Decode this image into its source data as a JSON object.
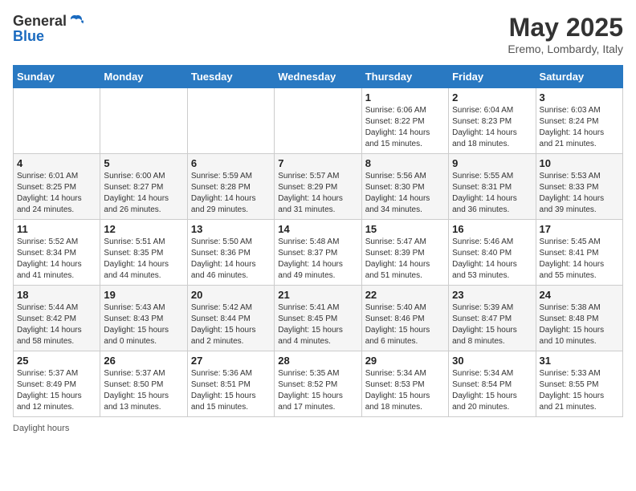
{
  "header": {
    "logo_general": "General",
    "logo_blue": "Blue",
    "title": "May 2025",
    "subtitle": "Eremo, Lombardy, Italy"
  },
  "days_of_week": [
    "Sunday",
    "Monday",
    "Tuesday",
    "Wednesday",
    "Thursday",
    "Friday",
    "Saturday"
  ],
  "weeks": [
    [
      {
        "day": "",
        "info": ""
      },
      {
        "day": "",
        "info": ""
      },
      {
        "day": "",
        "info": ""
      },
      {
        "day": "",
        "info": ""
      },
      {
        "day": "1",
        "info": "Sunrise: 6:06 AM\nSunset: 8:22 PM\nDaylight: 14 hours and 15 minutes."
      },
      {
        "day": "2",
        "info": "Sunrise: 6:04 AM\nSunset: 8:23 PM\nDaylight: 14 hours and 18 minutes."
      },
      {
        "day": "3",
        "info": "Sunrise: 6:03 AM\nSunset: 8:24 PM\nDaylight: 14 hours and 21 minutes."
      }
    ],
    [
      {
        "day": "4",
        "info": "Sunrise: 6:01 AM\nSunset: 8:25 PM\nDaylight: 14 hours and 24 minutes."
      },
      {
        "day": "5",
        "info": "Sunrise: 6:00 AM\nSunset: 8:27 PM\nDaylight: 14 hours and 26 minutes."
      },
      {
        "day": "6",
        "info": "Sunrise: 5:59 AM\nSunset: 8:28 PM\nDaylight: 14 hours and 29 minutes."
      },
      {
        "day": "7",
        "info": "Sunrise: 5:57 AM\nSunset: 8:29 PM\nDaylight: 14 hours and 31 minutes."
      },
      {
        "day": "8",
        "info": "Sunrise: 5:56 AM\nSunset: 8:30 PM\nDaylight: 14 hours and 34 minutes."
      },
      {
        "day": "9",
        "info": "Sunrise: 5:55 AM\nSunset: 8:31 PM\nDaylight: 14 hours and 36 minutes."
      },
      {
        "day": "10",
        "info": "Sunrise: 5:53 AM\nSunset: 8:33 PM\nDaylight: 14 hours and 39 minutes."
      }
    ],
    [
      {
        "day": "11",
        "info": "Sunrise: 5:52 AM\nSunset: 8:34 PM\nDaylight: 14 hours and 41 minutes."
      },
      {
        "day": "12",
        "info": "Sunrise: 5:51 AM\nSunset: 8:35 PM\nDaylight: 14 hours and 44 minutes."
      },
      {
        "day": "13",
        "info": "Sunrise: 5:50 AM\nSunset: 8:36 PM\nDaylight: 14 hours and 46 minutes."
      },
      {
        "day": "14",
        "info": "Sunrise: 5:48 AM\nSunset: 8:37 PM\nDaylight: 14 hours and 49 minutes."
      },
      {
        "day": "15",
        "info": "Sunrise: 5:47 AM\nSunset: 8:39 PM\nDaylight: 14 hours and 51 minutes."
      },
      {
        "day": "16",
        "info": "Sunrise: 5:46 AM\nSunset: 8:40 PM\nDaylight: 14 hours and 53 minutes."
      },
      {
        "day": "17",
        "info": "Sunrise: 5:45 AM\nSunset: 8:41 PM\nDaylight: 14 hours and 55 minutes."
      }
    ],
    [
      {
        "day": "18",
        "info": "Sunrise: 5:44 AM\nSunset: 8:42 PM\nDaylight: 14 hours and 58 minutes."
      },
      {
        "day": "19",
        "info": "Sunrise: 5:43 AM\nSunset: 8:43 PM\nDaylight: 15 hours and 0 minutes."
      },
      {
        "day": "20",
        "info": "Sunrise: 5:42 AM\nSunset: 8:44 PM\nDaylight: 15 hours and 2 minutes."
      },
      {
        "day": "21",
        "info": "Sunrise: 5:41 AM\nSunset: 8:45 PM\nDaylight: 15 hours and 4 minutes."
      },
      {
        "day": "22",
        "info": "Sunrise: 5:40 AM\nSunset: 8:46 PM\nDaylight: 15 hours and 6 minutes."
      },
      {
        "day": "23",
        "info": "Sunrise: 5:39 AM\nSunset: 8:47 PM\nDaylight: 15 hours and 8 minutes."
      },
      {
        "day": "24",
        "info": "Sunrise: 5:38 AM\nSunset: 8:48 PM\nDaylight: 15 hours and 10 minutes."
      }
    ],
    [
      {
        "day": "25",
        "info": "Sunrise: 5:37 AM\nSunset: 8:49 PM\nDaylight: 15 hours and 12 minutes."
      },
      {
        "day": "26",
        "info": "Sunrise: 5:37 AM\nSunset: 8:50 PM\nDaylight: 15 hours and 13 minutes."
      },
      {
        "day": "27",
        "info": "Sunrise: 5:36 AM\nSunset: 8:51 PM\nDaylight: 15 hours and 15 minutes."
      },
      {
        "day": "28",
        "info": "Sunrise: 5:35 AM\nSunset: 8:52 PM\nDaylight: 15 hours and 17 minutes."
      },
      {
        "day": "29",
        "info": "Sunrise: 5:34 AM\nSunset: 8:53 PM\nDaylight: 15 hours and 18 minutes."
      },
      {
        "day": "30",
        "info": "Sunrise: 5:34 AM\nSunset: 8:54 PM\nDaylight: 15 hours and 20 minutes."
      },
      {
        "day": "31",
        "info": "Sunrise: 5:33 AM\nSunset: 8:55 PM\nDaylight: 15 hours and 21 minutes."
      }
    ]
  ],
  "footer": "Daylight hours"
}
